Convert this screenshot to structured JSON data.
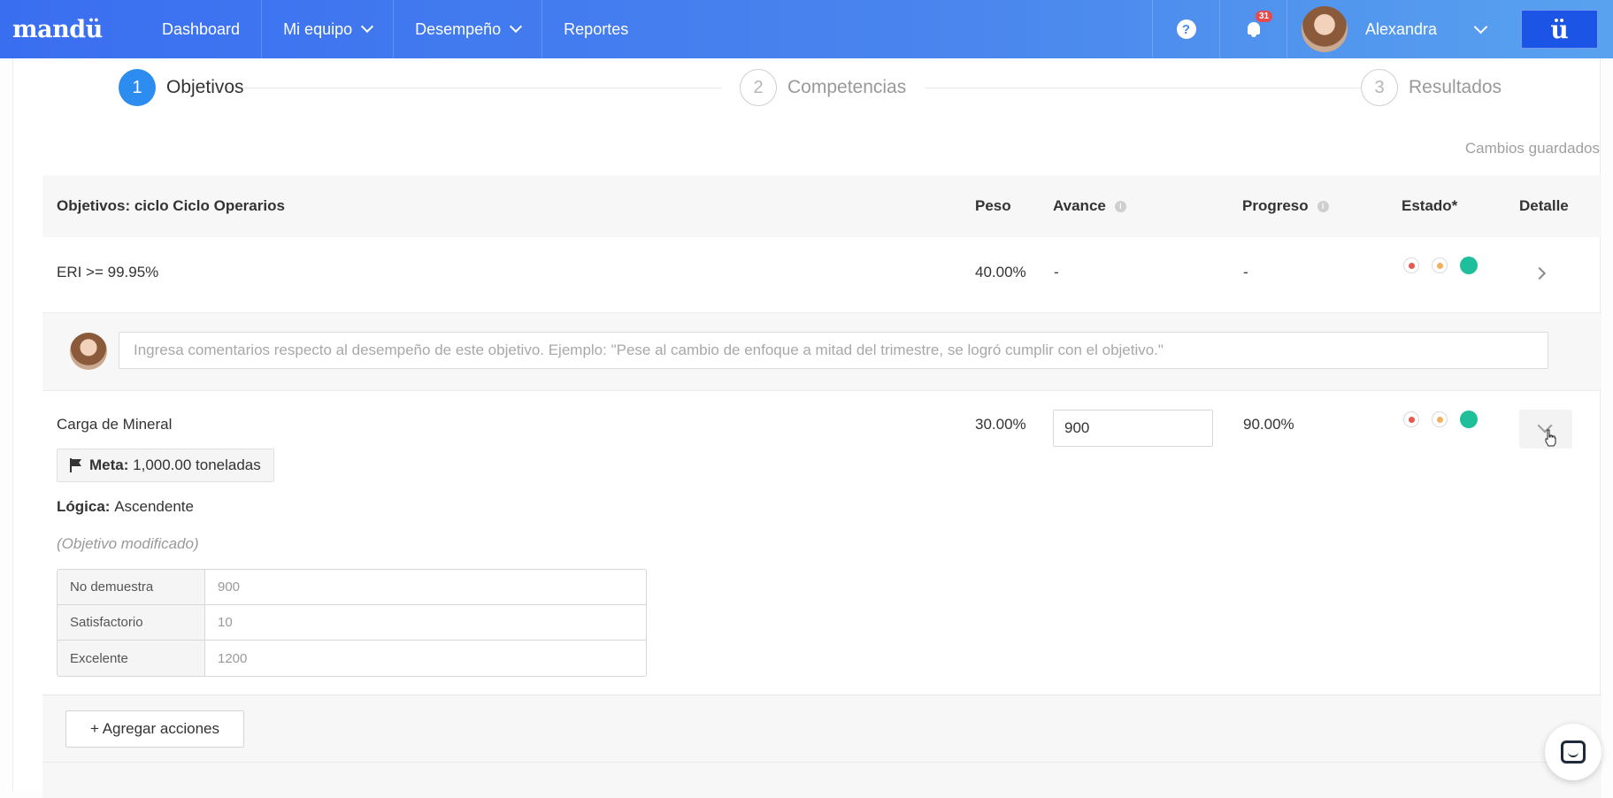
{
  "nav": {
    "logo": "mandü",
    "items": [
      {
        "label": "Dashboard",
        "dropdown": false
      },
      {
        "label": "Mi equipo",
        "dropdown": true
      },
      {
        "label": "Desempeño",
        "dropdown": true
      },
      {
        "label": "Reportes",
        "dropdown": false
      }
    ],
    "help_icon": "?",
    "notification_count": "31",
    "user_name": "Alexandra",
    "brand_button": "ü"
  },
  "steps": [
    {
      "number": "1",
      "label": "Objetivos",
      "active": true
    },
    {
      "number": "2",
      "label": "Competencias",
      "active": false
    },
    {
      "number": "3",
      "label": "Resultados",
      "active": false
    }
  ],
  "status_text": "Cambios guardados",
  "table": {
    "headers": {
      "objective": "Objetivos: ciclo Ciclo Operarios",
      "weight": "Peso",
      "progress_input": "Avance",
      "progress": "Progreso",
      "state": "Estado*",
      "detail": "Detalle"
    },
    "rows": [
      {
        "name": "ERI >= 99.95%",
        "weight": "40.00%",
        "avance": "-",
        "progreso": "-",
        "comment_placeholder": "Ingresa comentarios respecto al desempeño de este objetivo. Ejemplo: \"Pese al cambio de enfoque a mitad del trimestre, se logró cumplir con el objetivo.\""
      },
      {
        "name": "Carga de Mineral",
        "weight": "30.00%",
        "avance_value": "900",
        "progreso": "90.00%",
        "meta_label": "Meta:",
        "meta_value": "1,000.00 toneladas",
        "logic_label": "Lógica:",
        "logic_value": "Ascendente",
        "modified_note": "(Objetivo modificado)",
        "scale": [
          {
            "label": "No demuestra",
            "value": "900"
          },
          {
            "label": "Satisfactorio",
            "value": "10"
          },
          {
            "label": "Excelente",
            "value": "1200"
          }
        ],
        "add_actions_label": "+ Agregar acciones"
      }
    ]
  },
  "colors": {
    "nav_start": "#3a6ef0",
    "nav_end": "#58a2ef",
    "step_active": "#2d8cf0",
    "status_red": "#e8584f",
    "status_orange": "#f3b05c",
    "status_green": "#1fbf9b",
    "badge": "#e84a4a"
  }
}
